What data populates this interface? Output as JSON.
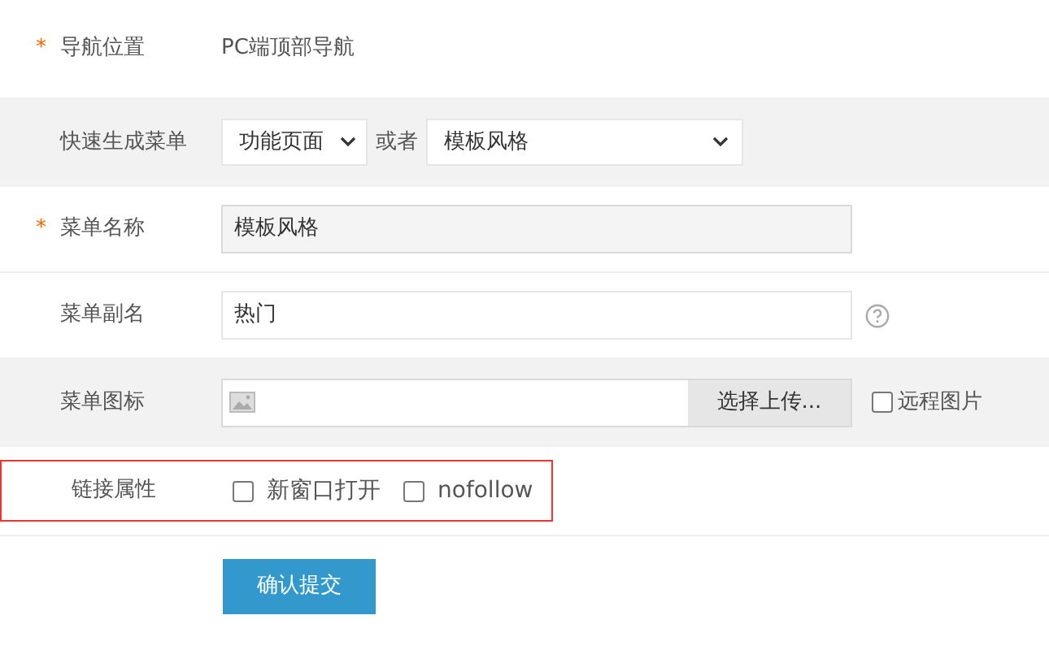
{
  "rows": [
    {
      "kind": "text",
      "label": "导航位置",
      "required_mark": "*",
      "shaded": false,
      "value": "PC端顶部导航"
    },
    {
      "kind": "selects",
      "label": "快速生成菜单",
      "shaded": true,
      "first": "功能页面",
      "joiner": "或者",
      "second": "模板风格"
    },
    {
      "kind": "input",
      "label": "菜单名称",
      "required_mark": "*",
      "shaded": false,
      "value": "模板风格",
      "disabled": true
    },
    {
      "kind": "input",
      "label": "菜单副名",
      "shaded": false,
      "value": "热门",
      "disabled": false,
      "help": true
    },
    {
      "kind": "upload",
      "label": "菜单图标",
      "shaded": true,
      "button": "选择上传...",
      "remote": {
        "label": "远程图片",
        "checked": false
      }
    },
    {
      "kind": "checks",
      "label": "链接属性",
      "shaded": false,
      "highlighted": true,
      "options": [
        {
          "label": "新窗口打开",
          "checked": false
        },
        {
          "label": "nofollow",
          "checked": false
        }
      ]
    }
  ],
  "submit": "确认提交"
}
